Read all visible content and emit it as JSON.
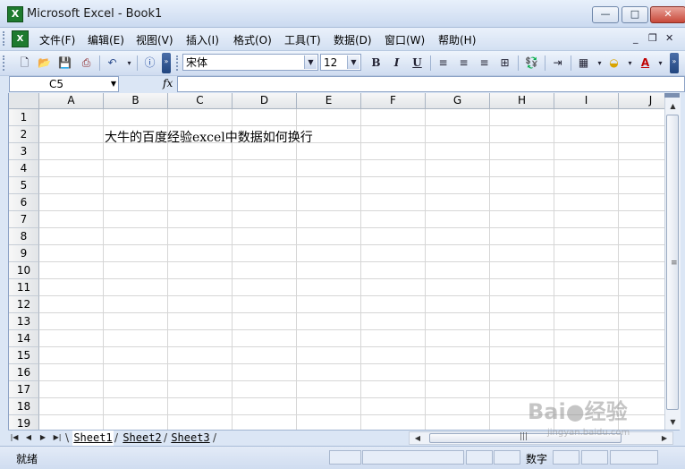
{
  "window": {
    "title": "Microsoft Excel - Book1",
    "app_icon": "excel-icon",
    "minimize": "—",
    "maximize": "□",
    "close": "✕"
  },
  "menubar": {
    "items": [
      "文件(F)",
      "编辑(E)",
      "视图(V)",
      "插入(I)",
      "格式(O)",
      "工具(T)",
      "数据(D)",
      "窗口(W)",
      "帮助(H)"
    ],
    "doc_controls": [
      "_",
      "❒",
      "✕"
    ]
  },
  "toolbar": {
    "font_name": "宋体",
    "font_size": "12",
    "bold": "B",
    "italic": "I",
    "underline": "U"
  },
  "formula_bar": {
    "name_box": "C5",
    "fx": "fx",
    "formula": ""
  },
  "grid": {
    "columns": [
      "A",
      "B",
      "C",
      "D",
      "E",
      "F",
      "G",
      "H",
      "I",
      "J"
    ],
    "rows": [
      "1",
      "2",
      "3",
      "4",
      "5",
      "6",
      "7",
      "8",
      "9",
      "10",
      "11",
      "12",
      "13",
      "14",
      "15",
      "16",
      "17",
      "18",
      "19"
    ],
    "cell_B2": "大牛的百度经验excel中数据如何换行"
  },
  "sheets": {
    "tabs": [
      "Sheet1",
      "Sheet2",
      "Sheet3"
    ],
    "active": "Sheet1"
  },
  "statusbar": {
    "ready": "就绪",
    "mode": "数字"
  },
  "watermark": {
    "logo": "Bai●经验",
    "site": "jingyan.baidu.com"
  }
}
